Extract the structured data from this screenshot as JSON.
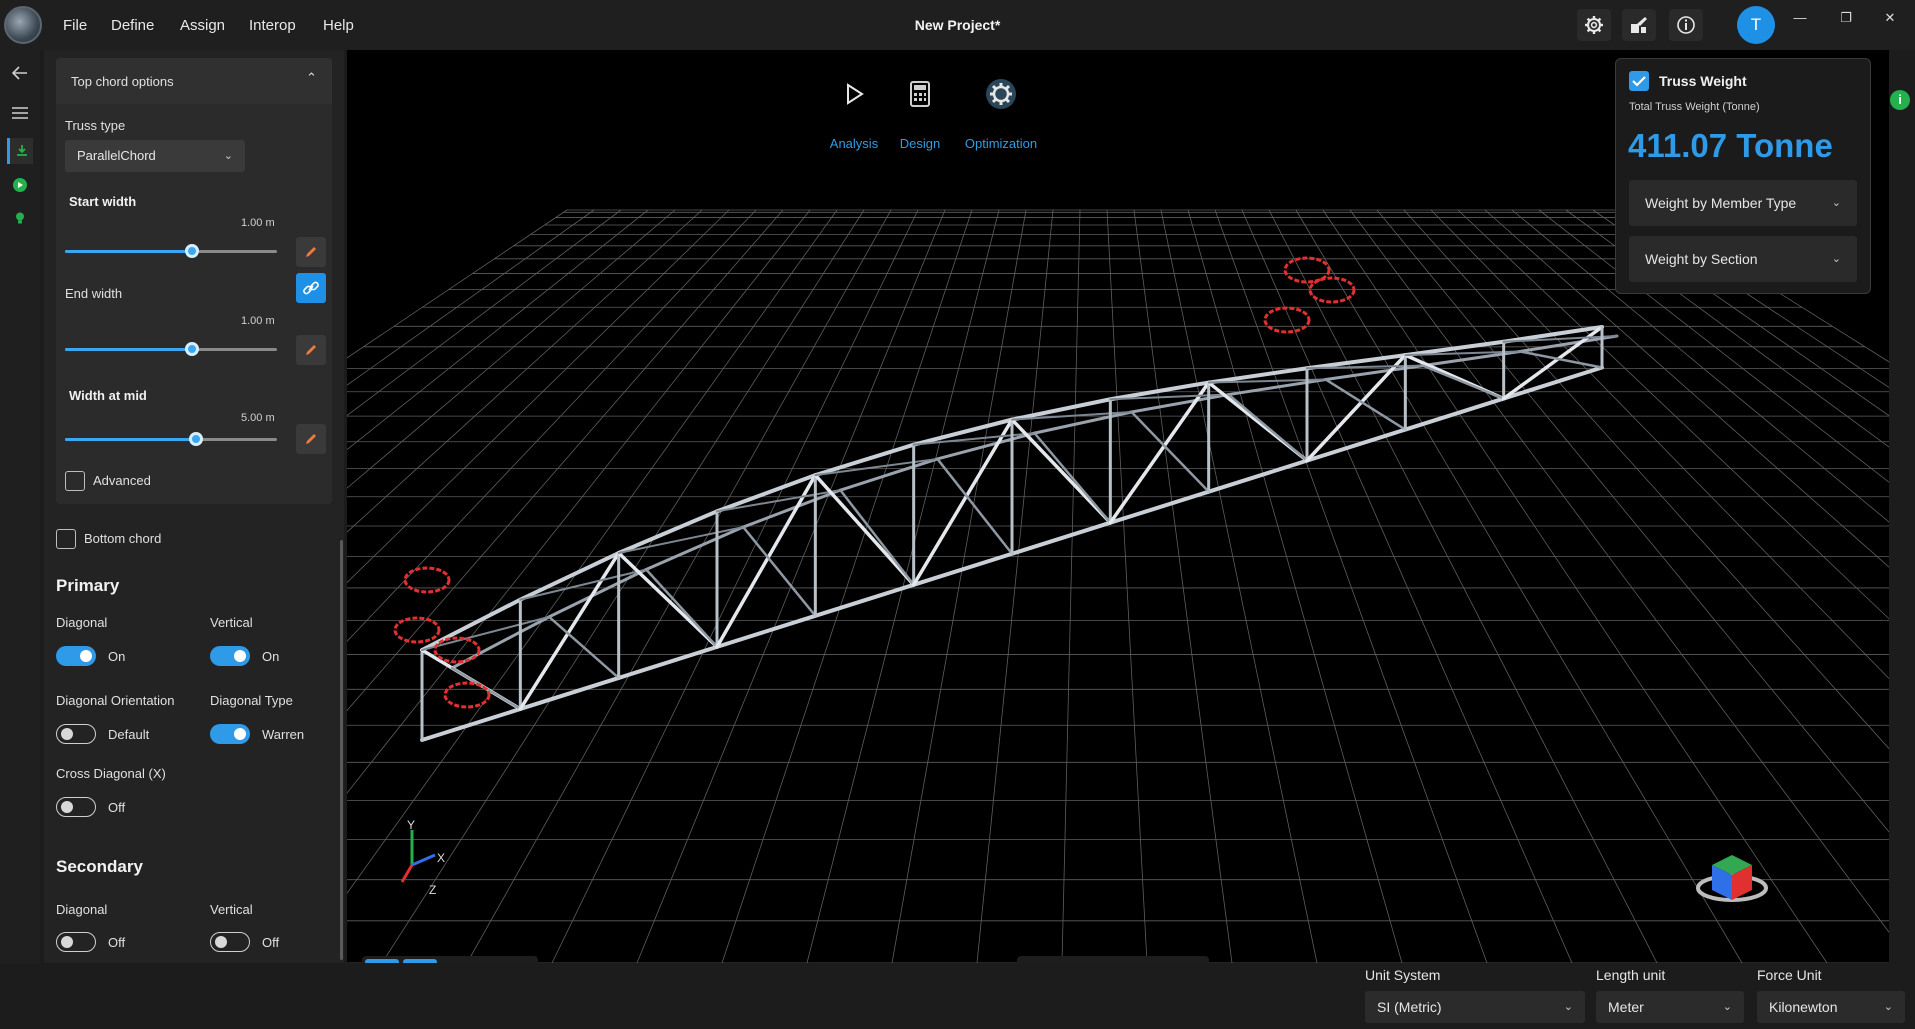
{
  "menu": {
    "file": "File",
    "define": "Define",
    "assign": "Assign",
    "interop": "Interop",
    "help": "Help"
  },
  "project_title": "New Project*",
  "user_initial": "T",
  "panel": {
    "top_chord": {
      "header": "Top chord options",
      "truss_type_label": "Truss type",
      "truss_type_value": "ParallelChord",
      "start_width_label": "Start width",
      "start_width_value": "1.00 m",
      "start_width_fraction": 0.6,
      "end_width_label": "End width",
      "end_width_value": "1.00 m",
      "end_width_fraction": 0.6,
      "mid_width_label": "Width at mid",
      "mid_width_value": "5.00 m",
      "mid_width_fraction": 0.62,
      "advanced_label": "Advanced"
    },
    "bottom_chord_label": "Bottom chord",
    "primary": {
      "title": "Primary",
      "diagonal_label": "Diagonal",
      "diagonal_state": "On",
      "vertical_label": "Vertical",
      "vertical_state": "On",
      "diag_orientation_label": "Diagonal Orientation",
      "diag_orientation_state": "Default",
      "diag_type_label": "Diagonal Type",
      "diag_type_state": "Warren",
      "cross_diag_label": "Cross Diagonal (X)",
      "cross_diag_state": "Off"
    },
    "secondary": {
      "title": "Secondary",
      "diagonal_label": "Diagonal",
      "diagonal_state": "Off",
      "vertical_label": "Vertical",
      "vertical_state": "Off"
    }
  },
  "modes": {
    "analysis": "Analysis",
    "design": "Design",
    "optimization": "Optimization"
  },
  "weight_card": {
    "title": "Truss Weight",
    "subtitle": "Total Truss Weight (Tonne)",
    "value": "411.07 Tonne",
    "by_member_type": "Weight by Member Type",
    "by_section": "Weight by Section"
  },
  "axes": {
    "x": "X",
    "y": "Y",
    "z": "Z"
  },
  "status": {
    "unit_system_label": "Unit System",
    "unit_system_value": "SI (Metric)",
    "length_unit_label": "Length unit",
    "length_unit_value": "Meter",
    "force_unit_label": "Force Unit",
    "force_unit_value": "Kilonewton"
  },
  "colors": {
    "accent": "#2f9ae8",
    "success": "#22b14c",
    "support": "#e03030"
  }
}
